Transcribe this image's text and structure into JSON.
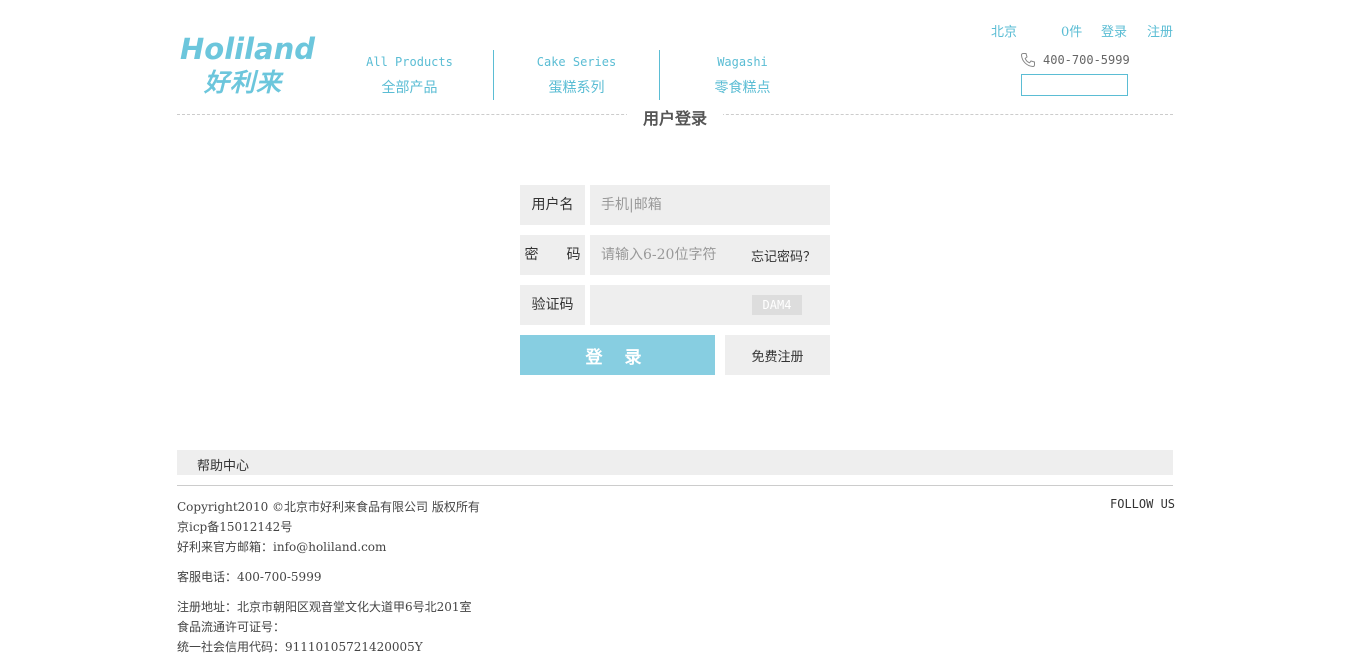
{
  "logo": {
    "en": "Holiland",
    "cn": "好利来"
  },
  "nav": [
    {
      "en": "All Products",
      "cn": "全部产品"
    },
    {
      "en": "Cake Series",
      "cn": "蛋糕系列"
    },
    {
      "en": "Wagashi",
      "cn": "零食糕点"
    }
  ],
  "top": {
    "city": "北京",
    "cart": "0件",
    "login": "登录",
    "register": "注册",
    "phone": "400-700-5999"
  },
  "page_title": "用户登录",
  "form": {
    "username_label": "用户名",
    "username_placeholder": "手机|邮箱",
    "password_label": "密　　码",
    "password_placeholder": "请输入6-20位字符",
    "forgot": "忘记密码？",
    "captcha_label": "验证码",
    "captcha_code": "DAM4",
    "login_button": "登 录",
    "register_button": "免费注册"
  },
  "footer": {
    "help": "帮助中心",
    "copyright": "Copyright2010 ©北京市好利来食品有限公司 版权所有",
    "icp": "京icp备15012142号",
    "email": "好利来官方邮箱：info@holiland.com",
    "service": "客服电话：400-700-5999",
    "address": "注册地址：北京市朝阳区观音堂文化大道甲6号北201室",
    "license": "食品流通许可证号：",
    "credit": "统一社会信用代码：91110105721420005Y",
    "follow": "FOLLOW US"
  },
  "colors": {
    "accent": "#5bbdd4",
    "button": "#87cee1",
    "field_bg": "#eeeeee"
  }
}
